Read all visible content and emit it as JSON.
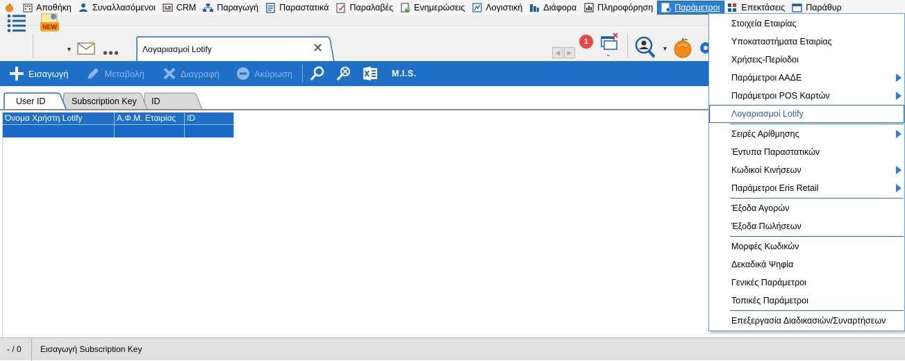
{
  "menubar": {
    "items": [
      {
        "label": "Αποθήκη",
        "icon": "building-icon"
      },
      {
        "label": "Συναλλασόμενοι",
        "icon": "person-icon"
      },
      {
        "label": "CRM",
        "icon": "crm-icon"
      },
      {
        "label": "Παραγωγή",
        "icon": "hierarchy-icon"
      },
      {
        "label": "Παραστατικά",
        "icon": "document-icon"
      },
      {
        "label": "Παραλαβές",
        "icon": "checklist-icon"
      },
      {
        "label": "Ενημερώσεις",
        "icon": "refresh-document-icon"
      },
      {
        "label": "Λογιστική",
        "icon": "chart-icon"
      },
      {
        "label": "Διάφορα",
        "icon": "grid-chart-icon"
      },
      {
        "label": "Πληροφόρηση",
        "icon": "bar-chart-icon"
      },
      {
        "label": "Παράμετροι",
        "icon": "settings-document-icon",
        "active": true
      },
      {
        "label": "Επεκτάσεις",
        "icon": "extensions-icon"
      },
      {
        "label": "Παράθυρ",
        "icon": "window-icon"
      }
    ]
  },
  "toolbar": {
    "doc_tab_label": "Λογαριασμοί Lotify",
    "new_label": "NEW",
    "notification_count": "1"
  },
  "actionbar": {
    "insert": "Εισαγωγή",
    "edit": "Μεταβολή",
    "delete": "Διαγραφή",
    "cancel": "Ακύρωση",
    "mis": "M.I.S."
  },
  "subtabs": [
    {
      "label": "User ID",
      "active": true
    },
    {
      "label": "Subscription Key",
      "active": false
    },
    {
      "label": "ID",
      "active": false
    }
  ],
  "grid": {
    "columns": [
      "Όνομα Χρήστη Lotify",
      "Α.Φ.Μ. Εταιρίας",
      "ID"
    ],
    "rows": [
      [
        "",
        "",
        ""
      ]
    ]
  },
  "statusbar": {
    "count": "- / 0",
    "message": "Εισαγωγή Subscription Key"
  },
  "dropdown": {
    "items": [
      {
        "label": "Στοιχεία Εταιρίας",
        "submenu": false
      },
      {
        "label": "Υποκαταστήματα Εταιρίας",
        "submenu": false
      },
      {
        "label": "Χρήσεις-Περίοδοι",
        "submenu": false
      },
      {
        "label": "Παράμετροι ΑΑΔΕ",
        "submenu": true
      },
      {
        "label": "Παράμετροι POS Καρτών",
        "submenu": true
      },
      {
        "label": "Λογαριασμοί Lotify",
        "submenu": false,
        "highlighted": true
      },
      {
        "label": "Σειρές Αρίθμησης",
        "submenu": true
      },
      {
        "label": "Έντυπα Παραστατικών",
        "submenu": false
      },
      {
        "label": "Κωδικοί Κινήσεων",
        "submenu": true
      },
      {
        "label": "Παράμετροι Eris Retail",
        "submenu": true
      },
      {
        "label": "Έξοδα Αγορών",
        "submenu": false
      },
      {
        "label": "Έξοδα Πωλήσεων",
        "submenu": false
      },
      {
        "label": "Μορφές Κωδικών",
        "submenu": false
      },
      {
        "label": "Δεκαδικά Ψηφία",
        "submenu": false
      },
      {
        "label": "Γενικές Παράμετροι",
        "submenu": false
      },
      {
        "label": "Τοπικές Παράμετροι",
        "submenu": false
      },
      {
        "label": "Επεξεργασία Διαδικασιών/Συναρτήσεων",
        "submenu": false
      }
    ]
  },
  "colors": {
    "accent_blue": "#1e6fc5",
    "menu_active": "#2b7fd6",
    "badge_red": "#e84646"
  }
}
